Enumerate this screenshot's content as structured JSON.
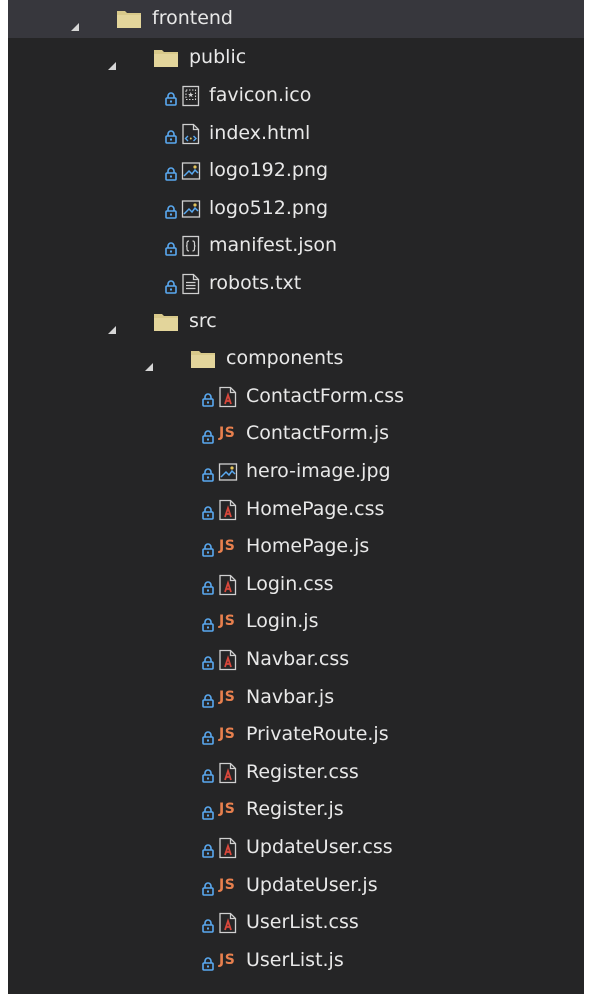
{
  "tree": [
    {
      "label": "frontend",
      "type": "folder",
      "depth": 0,
      "expanded": true,
      "selected": true
    },
    {
      "label": "public",
      "type": "folder",
      "depth": 1,
      "expanded": true
    },
    {
      "label": "favicon.ico",
      "type": "file",
      "icon": "favicon-icon",
      "depth": 2,
      "locked": true
    },
    {
      "label": "index.html",
      "type": "file",
      "icon": "html-file-icon",
      "depth": 2,
      "locked": true
    },
    {
      "label": "logo192.png",
      "type": "file",
      "icon": "image-file-icon",
      "depth": 2,
      "locked": true
    },
    {
      "label": "logo512.png",
      "type": "file",
      "icon": "image-file-icon",
      "depth": 2,
      "locked": true
    },
    {
      "label": "manifest.json",
      "type": "file",
      "icon": "json-file-icon",
      "depth": 2,
      "locked": true
    },
    {
      "label": "robots.txt",
      "type": "file",
      "icon": "text-file-icon",
      "depth": 2,
      "locked": true
    },
    {
      "label": "src",
      "type": "folder",
      "depth": 1,
      "expanded": true
    },
    {
      "label": "components",
      "type": "folder",
      "depth": 2,
      "expanded": true
    },
    {
      "label": "ContactForm.css",
      "type": "file",
      "icon": "css-file-icon",
      "depth": 3,
      "locked": true
    },
    {
      "label": "ContactForm.js",
      "type": "file",
      "icon": "js-file-icon",
      "depth": 3,
      "locked": true
    },
    {
      "label": "hero-image.jpg",
      "type": "file",
      "icon": "image-file-icon",
      "depth": 3,
      "locked": true
    },
    {
      "label": "HomePage.css",
      "type": "file",
      "icon": "css-file-icon",
      "depth": 3,
      "locked": true
    },
    {
      "label": "HomePage.js",
      "type": "file",
      "icon": "js-file-icon",
      "depth": 3,
      "locked": true
    },
    {
      "label": "Login.css",
      "type": "file",
      "icon": "css-file-icon",
      "depth": 3,
      "locked": true
    },
    {
      "label": "Login.js",
      "type": "file",
      "icon": "js-file-icon",
      "depth": 3,
      "locked": true
    },
    {
      "label": "Navbar.css",
      "type": "file",
      "icon": "css-file-icon",
      "depth": 3,
      "locked": true
    },
    {
      "label": "Navbar.js",
      "type": "file",
      "icon": "js-file-icon",
      "depth": 3,
      "locked": true
    },
    {
      "label": "PrivateRoute.js",
      "type": "file",
      "icon": "js-file-icon",
      "depth": 3,
      "locked": true
    },
    {
      "label": "Register.css",
      "type": "file",
      "icon": "css-file-icon",
      "depth": 3,
      "locked": true
    },
    {
      "label": "Register.js",
      "type": "file",
      "icon": "js-file-icon",
      "depth": 3,
      "locked": true
    },
    {
      "label": "UpdateUser.css",
      "type": "file",
      "icon": "css-file-icon",
      "depth": 3,
      "locked": true
    },
    {
      "label": "UpdateUser.js",
      "type": "file",
      "icon": "js-file-icon",
      "depth": 3,
      "locked": true
    },
    {
      "label": "UserList.css",
      "type": "file",
      "icon": "css-file-icon",
      "depth": 3,
      "locked": true
    },
    {
      "label": "UserList.js",
      "type": "file",
      "icon": "js-file-icon",
      "depth": 3,
      "locked": true
    }
  ],
  "icon_labels": {
    "js": "JS"
  },
  "colors": {
    "panel_bg": "#252526",
    "selected_bg": "#37373d",
    "text": "#e8e8e8",
    "folder": "#d8c98a",
    "lock": "#5aa9f0",
    "js": "#e8804e",
    "css_accent": "#d9473b",
    "file_outline": "#d0d0d0"
  }
}
